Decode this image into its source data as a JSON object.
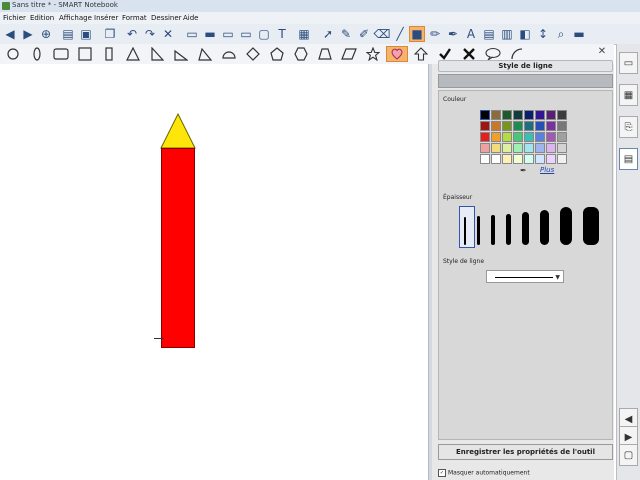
{
  "window": {
    "title": "Sans titre * - SMART Notebook"
  },
  "menu": [
    "Fichier",
    "Edition",
    "Affichage",
    "Insérer",
    "Format",
    "Dessiner",
    "Aide"
  ],
  "toolbar1": {
    "icons": [
      "back-icon",
      "forward-icon",
      "add-page-icon",
      "open-folder-icon",
      "save-icon",
      "paste-icon",
      "undo-icon",
      "redo-icon",
      "delete-icon",
      "screen-shade-icon",
      "display-icon",
      "screen-capture-icon",
      "dual-display-icon",
      "table-icon",
      "select-icon",
      "pen-icon",
      "creative-pen-icon",
      "eraser-icon",
      "line-icon",
      "shape-icon",
      "magic-pen-icon",
      "fill-icon",
      "text-icon",
      "properties-icon",
      "move-icon",
      "extra-icon"
    ]
  },
  "shapes": [
    "circle",
    "ellipse",
    "rounded-rect",
    "rect",
    "tall-rect",
    "triangle",
    "right-triangle",
    "flat-triangle",
    "angle-triangle",
    "semicircle",
    "diamond",
    "pentagon",
    "hexagon",
    "parallelogram",
    "star",
    "heart",
    "arrow-up",
    "check",
    "x",
    "speech",
    "arc"
  ],
  "panel": {
    "header": "Style de ligne",
    "color_label": "Couleur",
    "more_link": "Plus",
    "thickness_label": "Épaisseur",
    "line_style_label": "Style de ligne",
    "save_button": "Enregistrer les propriétés de l'outil",
    "auto_hide_label": "Masquer automatiquement"
  },
  "palette": [
    "#000000",
    "#8c6c3c",
    "#1e5a2c",
    "#123c3c",
    "#0a1e6e",
    "#321496",
    "#5a1e78",
    "#3c3c3c",
    "#a01414",
    "#c87828",
    "#78961e",
    "#1e8c50",
    "#1e6e82",
    "#2850b4",
    "#7832a0",
    "#787878",
    "#e61e1e",
    "#f0a028",
    "#b4dc3c",
    "#46c878",
    "#3cbeb4",
    "#5a82dc",
    "#a05ab4",
    "#a0a0a0",
    "#f0a0a0",
    "#f0dc78",
    "#dcf0a0",
    "#a0f0b4",
    "#a0e6f0",
    "#a0b4f0",
    "#dcb4f0",
    "#d2d2d2",
    "#ffffff",
    "#ffffff",
    "#fff0b4",
    "#f0ffd2",
    "#d2fff0",
    "#d2e6ff",
    "#f0d2ff",
    "#f0f0f0"
  ],
  "thicknesses": [
    2,
    3,
    4,
    5,
    7,
    9,
    12,
    16
  ]
}
